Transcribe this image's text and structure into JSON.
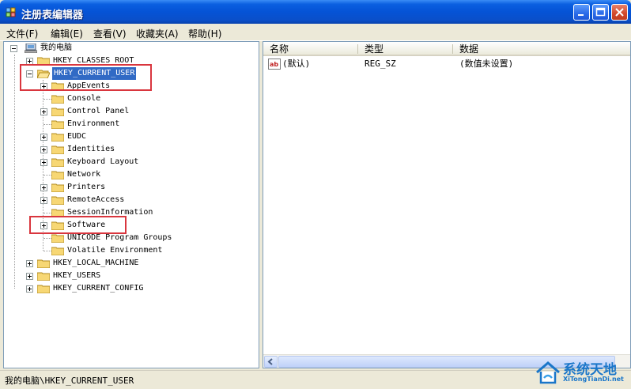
{
  "window": {
    "title": "注册表编辑器",
    "minimize": "minimize-button",
    "maximize": "maximize-button",
    "close": "close-button"
  },
  "menu": [
    "文件(F)",
    "编辑(E)",
    "查看(V)",
    "收藏夹(A)",
    "帮助(H)"
  ],
  "tree": {
    "root": "我的电脑",
    "hives": [
      "HKEY_CLASSES_ROOT",
      "HKEY_CURRENT_USER",
      "HKEY_LOCAL_MACHINE",
      "HKEY_USERS",
      "HKEY_CURRENT_CONFIG"
    ],
    "current_user_children": [
      {
        "label": "AppEvents",
        "expandable": true
      },
      {
        "label": "Console",
        "expandable": false
      },
      {
        "label": "Control Panel",
        "expandable": true
      },
      {
        "label": "Environment",
        "expandable": false
      },
      {
        "label": "EUDC",
        "expandable": true
      },
      {
        "label": "Identities",
        "expandable": true
      },
      {
        "label": "Keyboard Layout",
        "expandable": true
      },
      {
        "label": "Network",
        "expandable": false
      },
      {
        "label": "Printers",
        "expandable": true
      },
      {
        "label": "RemoteAccess",
        "expandable": true
      },
      {
        "label": "SessionInformation",
        "expandable": false
      },
      {
        "label": "Software",
        "expandable": true
      },
      {
        "label": "UNICODE Program Groups",
        "expandable": false
      },
      {
        "label": "Volatile Environment",
        "expandable": false
      }
    ],
    "selected": "HKEY_CURRENT_USER"
  },
  "values_pane": {
    "columns": [
      "名称",
      "类型",
      "数据"
    ],
    "rows": [
      {
        "name": "(默认)",
        "type": "REG_SZ",
        "data": "(数值未设置)"
      }
    ]
  },
  "status": "我的电脑\\HKEY_CURRENT_USER",
  "watermark": {
    "title": "系统天地",
    "url": "XiTongTianDi.net"
  },
  "colors": {
    "highlight": "#316ac5",
    "annotation": "#d9363e",
    "titlebar": "#0553d6"
  }
}
